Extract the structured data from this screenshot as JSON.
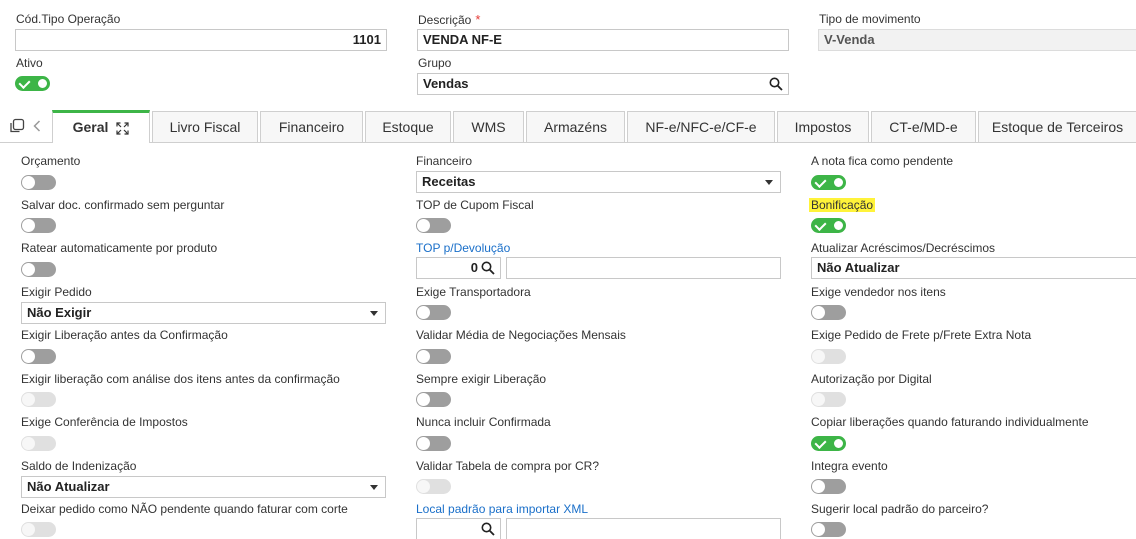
{
  "header": {
    "cod_label": "Cód.Tipo Operação",
    "cod_value": "1101",
    "descricao_label": "Descrição",
    "descricao_required": "*",
    "descricao_value": "VENDA NF-E",
    "tipo_mov_label": "Tipo de movimento",
    "tipo_mov_value": "V-Venda",
    "ativo_label": "Ativo",
    "grupo_label": "Grupo",
    "grupo_value": "Vendas"
  },
  "tabs": [
    {
      "label": "Geral"
    },
    {
      "label": "Livro Fiscal"
    },
    {
      "label": "Financeiro"
    },
    {
      "label": "Estoque"
    },
    {
      "label": "WMS"
    },
    {
      "label": "Armazéns"
    },
    {
      "label": "NF-e/NFC-e/CF-e"
    },
    {
      "label": "Impostos"
    },
    {
      "label": "CT-e/MD-e"
    },
    {
      "label": "Estoque de Terceiros"
    }
  ],
  "col1": {
    "orcamento": "Orçamento",
    "salvar_doc": "Salvar doc. confirmado sem perguntar",
    "ratear": "Ratear automaticamente por produto",
    "exigir_pedido": "Exigir Pedido",
    "exigir_pedido_value": "Não Exigir",
    "exigir_lib": "Exigir Liberação antes da Confirmação",
    "exigir_lib_analise": "Exigir liberação com análise dos itens antes da confirmação",
    "exige_conf": "Exige Conferência de Impostos",
    "saldo_ind": "Saldo de Indenização",
    "saldo_ind_value": "Não Atualizar",
    "deixar_pedido": "Deixar pedido como NÃO pendente quando faturar com corte"
  },
  "col2": {
    "financeiro": "Financeiro",
    "financeiro_value": "Receitas",
    "top_cupom": "TOP de Cupom Fiscal",
    "top_devolucao": "TOP p/Devolução",
    "top_devolucao_value": "0",
    "exige_transp": "Exige Transportadora",
    "validar_media": "Validar Média de Negociações Mensais",
    "sempre_lib": "Sempre exigir Liberação",
    "nunca_incluir": "Nunca incluir Confirmada",
    "validar_tabela": "Validar Tabela de compra por CR?",
    "local_padrao": "Local padrão para importar XML"
  },
  "col3": {
    "nota_pendente": "A nota fica como pendente",
    "bonificacao": "Bonificação",
    "atualizar_acresc": "Atualizar Acréscimos/Decréscimos",
    "atualizar_acresc_value": "Não Atualizar",
    "exige_vendedor": "Exige vendedor nos itens",
    "exige_frete": "Exige Pedido de Frete p/Frete Extra Nota",
    "autorizacao": "Autorização por Digital",
    "copiar_lib": "Copiar liberações quando faturando individualmente",
    "integra_evento": "Integra evento",
    "sugerir_local": "Sugerir local padrão do parceiro?"
  },
  "colors": {
    "toggle_on": "#3db547",
    "toggle_off": "#9e9e9e",
    "link": "#1a6fc9",
    "highlight": "#fff33a",
    "required": "#e53935"
  },
  "icons": {
    "search": "search-icon",
    "dropdown": "chevron-down-icon",
    "expand": "expand-icon",
    "copy": "copy-icon",
    "back": "chevron-left-icon"
  }
}
